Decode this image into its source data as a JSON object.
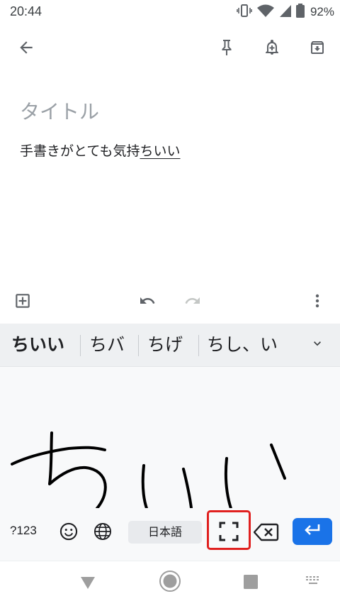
{
  "status_bar": {
    "time": "20:44",
    "battery_percent": "92%",
    "icons": [
      "vibrate-icon",
      "wifi-icon",
      "signal-icon",
      "battery-icon"
    ]
  },
  "app_bar": {
    "icons": [
      "back-arrow-icon",
      "pin-icon",
      "add-reminder-icon",
      "archive-icon"
    ]
  },
  "note": {
    "title_placeholder": "タイトル",
    "body_committed": "手書きがとても気持",
    "body_composing": "ちいい"
  },
  "editor_toolbar": {
    "icons": [
      "add-box-icon",
      "undo-icon",
      "redo-icon",
      "more-vert-icon"
    ],
    "redo_enabled": false
  },
  "keyboard": {
    "candidates": [
      "ちいい",
      "ちバ",
      "ちげ",
      "ちし、い"
    ],
    "expand_icon": "chevron-down-icon",
    "handwriting_text": "ちいい",
    "numbers_key": "?123",
    "emoji_icon": "emoji-icon",
    "language_icon": "globe-icon",
    "space_label": "日本語",
    "fullscreen_icon": "fullscreen-icon",
    "backspace_icon": "backspace-icon",
    "enter_icon": "enter-arrow-icon",
    "enter_color": "#1a73e8",
    "highlight_color": "#e0201f"
  },
  "nav_bar": {
    "icons": [
      "back-triangle-icon",
      "home-circle-icon",
      "recents-square-icon",
      "keyboard-switch-icon"
    ]
  }
}
